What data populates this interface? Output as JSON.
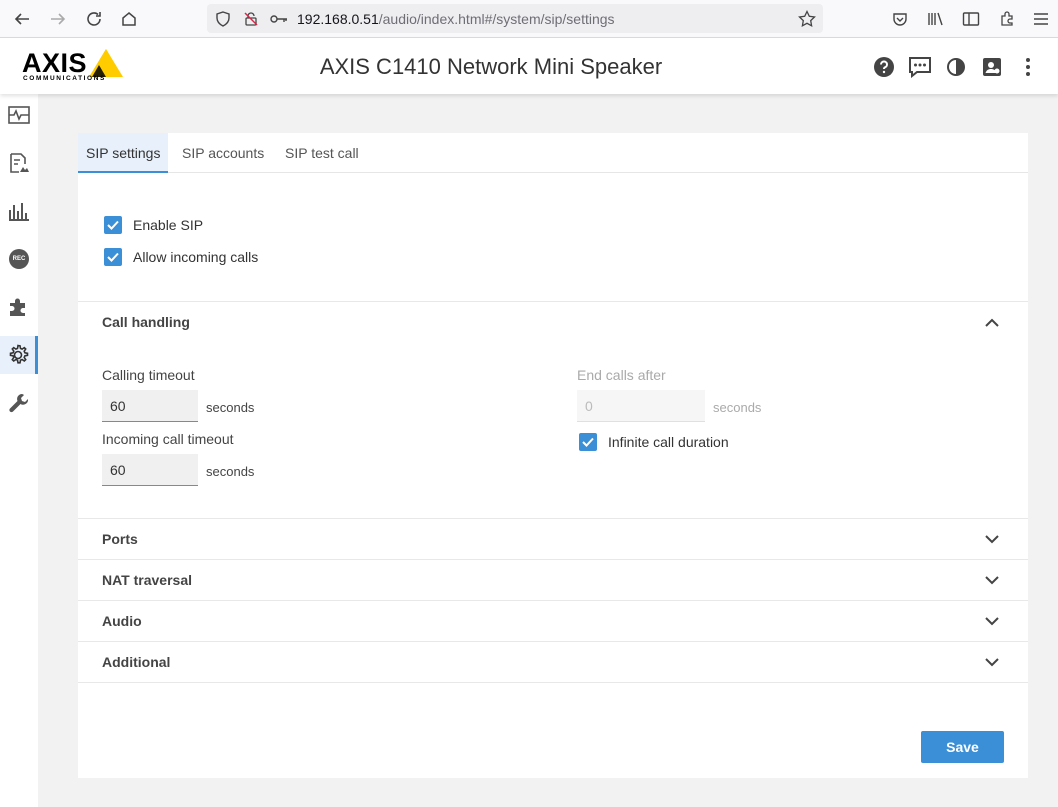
{
  "browser": {
    "url_host": "192.168.0.51",
    "url_path": "/audio/index.html#/system/sip/settings"
  },
  "header": {
    "logo_word": "AXIS",
    "logo_sub": "COMMUNICATIONS",
    "title": "AXIS C1410 Network Mini Speaker"
  },
  "sidenav": {
    "rec_label": "REC"
  },
  "tabs": [
    {
      "label": "SIP settings"
    },
    {
      "label": "SIP accounts"
    },
    {
      "label": "SIP test call"
    }
  ],
  "general": {
    "enable_sip": "Enable SIP",
    "allow_incoming": "Allow incoming calls"
  },
  "call_handling": {
    "title": "Call handling",
    "calling_timeout_label": "Calling timeout",
    "calling_timeout_value": "60",
    "calling_timeout_unit": "seconds",
    "incoming_timeout_label": "Incoming call timeout",
    "incoming_timeout_value": "60",
    "incoming_timeout_unit": "seconds",
    "end_calls_label": "End calls after",
    "end_calls_value": "0",
    "end_calls_unit": "seconds",
    "infinite_label": "Infinite call duration"
  },
  "sections": {
    "ports": "Ports",
    "nat": "NAT traversal",
    "audio": "Audio",
    "additional": "Additional"
  },
  "save_label": "Save",
  "colors": {
    "accent": "#3a8fd6",
    "logo_yellow": "#ffcc00"
  }
}
